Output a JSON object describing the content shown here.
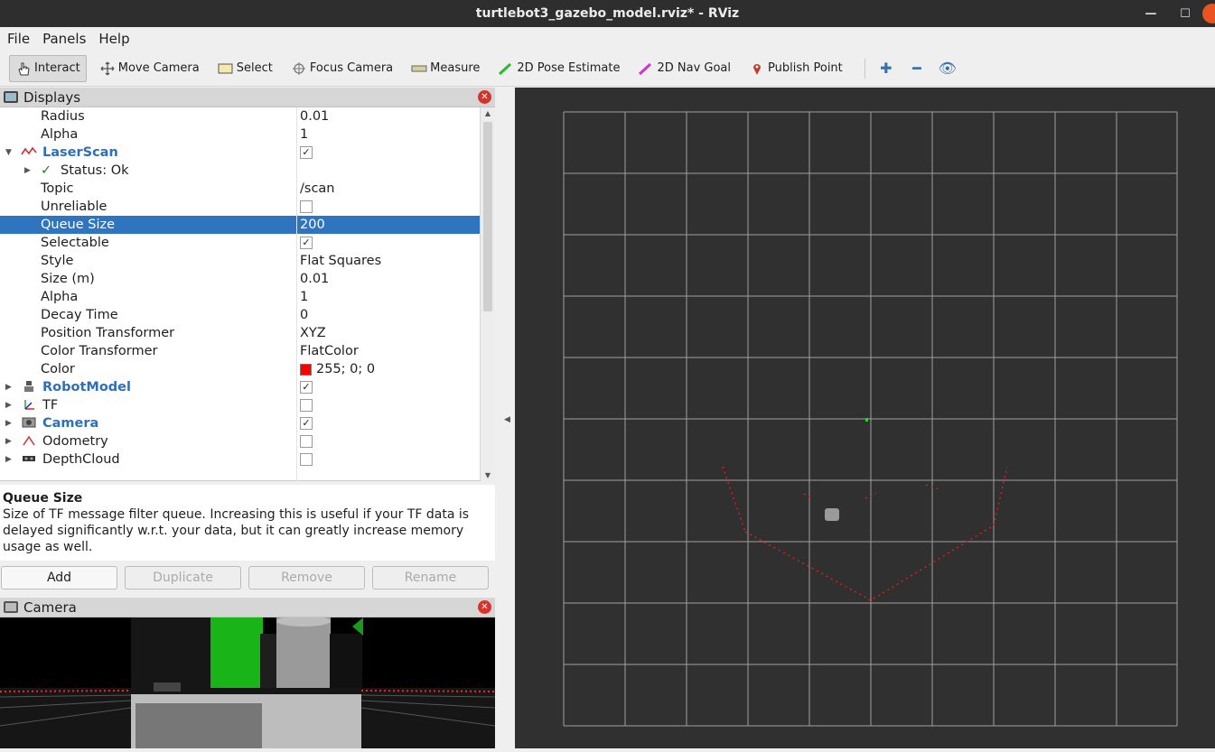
{
  "window": {
    "title": "turtlebot3_gazebo_model.rviz* - RViz"
  },
  "menu": [
    {
      "label": "File"
    },
    {
      "label": "Panels"
    },
    {
      "label": "Help"
    }
  ],
  "toolbar": {
    "tools": [
      {
        "label": "Interact",
        "icon": "hand-pointer-icon",
        "active": true
      },
      {
        "label": "Move Camera",
        "icon": "move-arrows-icon"
      },
      {
        "label": "Select",
        "icon": "select-box-icon"
      },
      {
        "label": "Focus Camera",
        "icon": "focus-target-icon"
      },
      {
        "label": "Measure",
        "icon": "ruler-icon"
      },
      {
        "label": "2D Pose Estimate",
        "icon": "green-arrow-icon"
      },
      {
        "label": "2D Nav Goal",
        "icon": "magenta-arrow-icon"
      },
      {
        "label": "Publish Point",
        "icon": "map-pin-icon"
      }
    ]
  },
  "displays": {
    "title": "Displays",
    "rows": [
      {
        "key": "Radius",
        "value": "0.01"
      },
      {
        "key": "Alpha",
        "value": "1"
      },
      {
        "key": "LaserScan",
        "value": "",
        "checked": true,
        "group": true,
        "icon": "laser-scan-icon"
      },
      {
        "key": "Status: Ok",
        "value": ""
      },
      {
        "key": "Topic",
        "value": "/scan"
      },
      {
        "key": "Unreliable",
        "value": "",
        "checked": false
      },
      {
        "key": "Queue Size",
        "value": "200",
        "selected": true
      },
      {
        "key": "Selectable",
        "value": "",
        "checked": true
      },
      {
        "key": "Style",
        "value": "Flat Squares"
      },
      {
        "key": "Size (m)",
        "value": "0.01"
      },
      {
        "key": "Alpha",
        "value": "1"
      },
      {
        "key": "Decay Time",
        "value": "0"
      },
      {
        "key": "Position Transformer",
        "value": "XYZ"
      },
      {
        "key": "Color Transformer",
        "value": "FlatColor"
      },
      {
        "key": "Color",
        "value": "255; 0; 0",
        "swatch": "#ff0000"
      },
      {
        "key": "RobotModel",
        "value": "",
        "checked": true,
        "group": true,
        "icon": "robot-model-icon"
      },
      {
        "key": "TF",
        "value": "",
        "checked": false,
        "icon": "tf-axes-icon"
      },
      {
        "key": "Camera",
        "value": "",
        "checked": true,
        "group": true,
        "icon": "camera-icon"
      },
      {
        "key": "Odometry",
        "value": "",
        "checked": false,
        "icon": "odometry-icon"
      },
      {
        "key": "DepthCloud",
        "value": "",
        "checked": false,
        "icon": "depth-cloud-icon"
      }
    ]
  },
  "description": {
    "title": "Queue Size",
    "text": "Size of TF message filter queue. Increasing this is useful if your TF data is delayed significantly w.r.t. your data, but it can greatly increase memory usage as well."
  },
  "buttons": {
    "add": "Add",
    "duplicate": "Duplicate",
    "remove": "Remove",
    "rename": "Rename"
  },
  "camera_panel": {
    "title": "Camera"
  },
  "colors": {
    "selection": "#2e74bf",
    "group_label": "#2f6fb7",
    "viewport_bg": "#303030",
    "grid": "#a0a0a0",
    "laser": "#ff0000"
  }
}
